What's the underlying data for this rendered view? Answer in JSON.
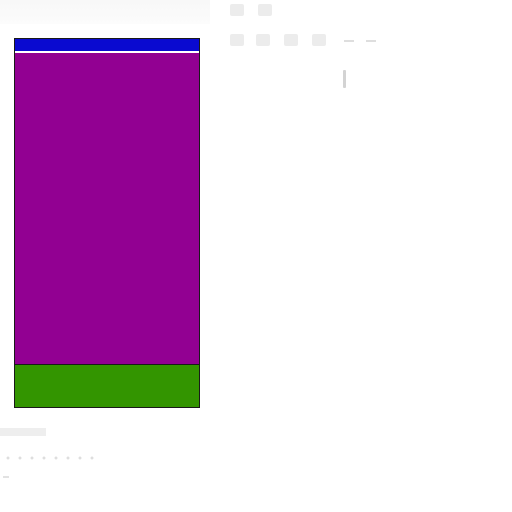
{
  "canvas": {
    "colors": {
      "background": "#ffffff",
      "outline": "#1a1a1a"
    }
  },
  "shape": {
    "bands": [
      {
        "name": "top-band",
        "color": "#0a0ad0"
      },
      {
        "name": "middle-band",
        "color": "#920092"
      },
      {
        "name": "bottom-band",
        "color": "#339500"
      }
    ]
  },
  "toolbar": {
    "icons": [
      "pointer-icon",
      "arrow-icon",
      "image-icon",
      "record-icon",
      "crop-icon",
      "layout-icon",
      "minus-icon",
      "minus-icon"
    ]
  }
}
